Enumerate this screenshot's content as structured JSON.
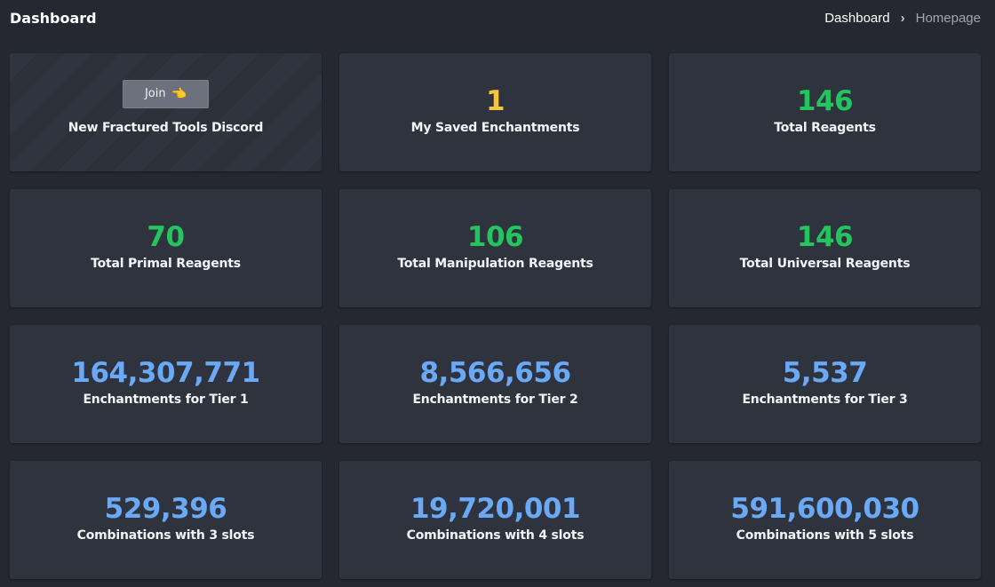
{
  "header": {
    "title": "Dashboard",
    "breadcrumb": {
      "parent": "Dashboard",
      "separator": "›",
      "current": "Homepage"
    }
  },
  "colors": {
    "background": "#252830",
    "card": "#2f333e",
    "green": "#22c55e",
    "yellow": "#f5c542",
    "blue": "#6aa9f5"
  },
  "discord_card": {
    "button_label": "Join",
    "button_icon": "pointing-hand-icon",
    "label": "New Fractured Tools Discord"
  },
  "stats": [
    {
      "value": "1",
      "label": "My Saved Enchantments",
      "color": "yellow"
    },
    {
      "value": "146",
      "label": "Total Reagents",
      "color": "green"
    },
    {
      "value": "70",
      "label": "Total Primal Reagents",
      "color": "green"
    },
    {
      "value": "106",
      "label": "Total Manipulation Reagents",
      "color": "green"
    },
    {
      "value": "146",
      "label": "Total Universal Reagents",
      "color": "green"
    },
    {
      "value": "164,307,771",
      "label": "Enchantments for Tier 1",
      "color": "blue"
    },
    {
      "value": "8,566,656",
      "label": "Enchantments for Tier 2",
      "color": "blue"
    },
    {
      "value": "5,537",
      "label": "Enchantments for Tier 3",
      "color": "blue"
    },
    {
      "value": "529,396",
      "label": "Combinations with 3 slots",
      "color": "blue"
    },
    {
      "value": "19,720,001",
      "label": "Combinations with 4 slots",
      "color": "blue"
    },
    {
      "value": "591,600,030",
      "label": "Combinations with 5 slots",
      "color": "blue"
    }
  ]
}
